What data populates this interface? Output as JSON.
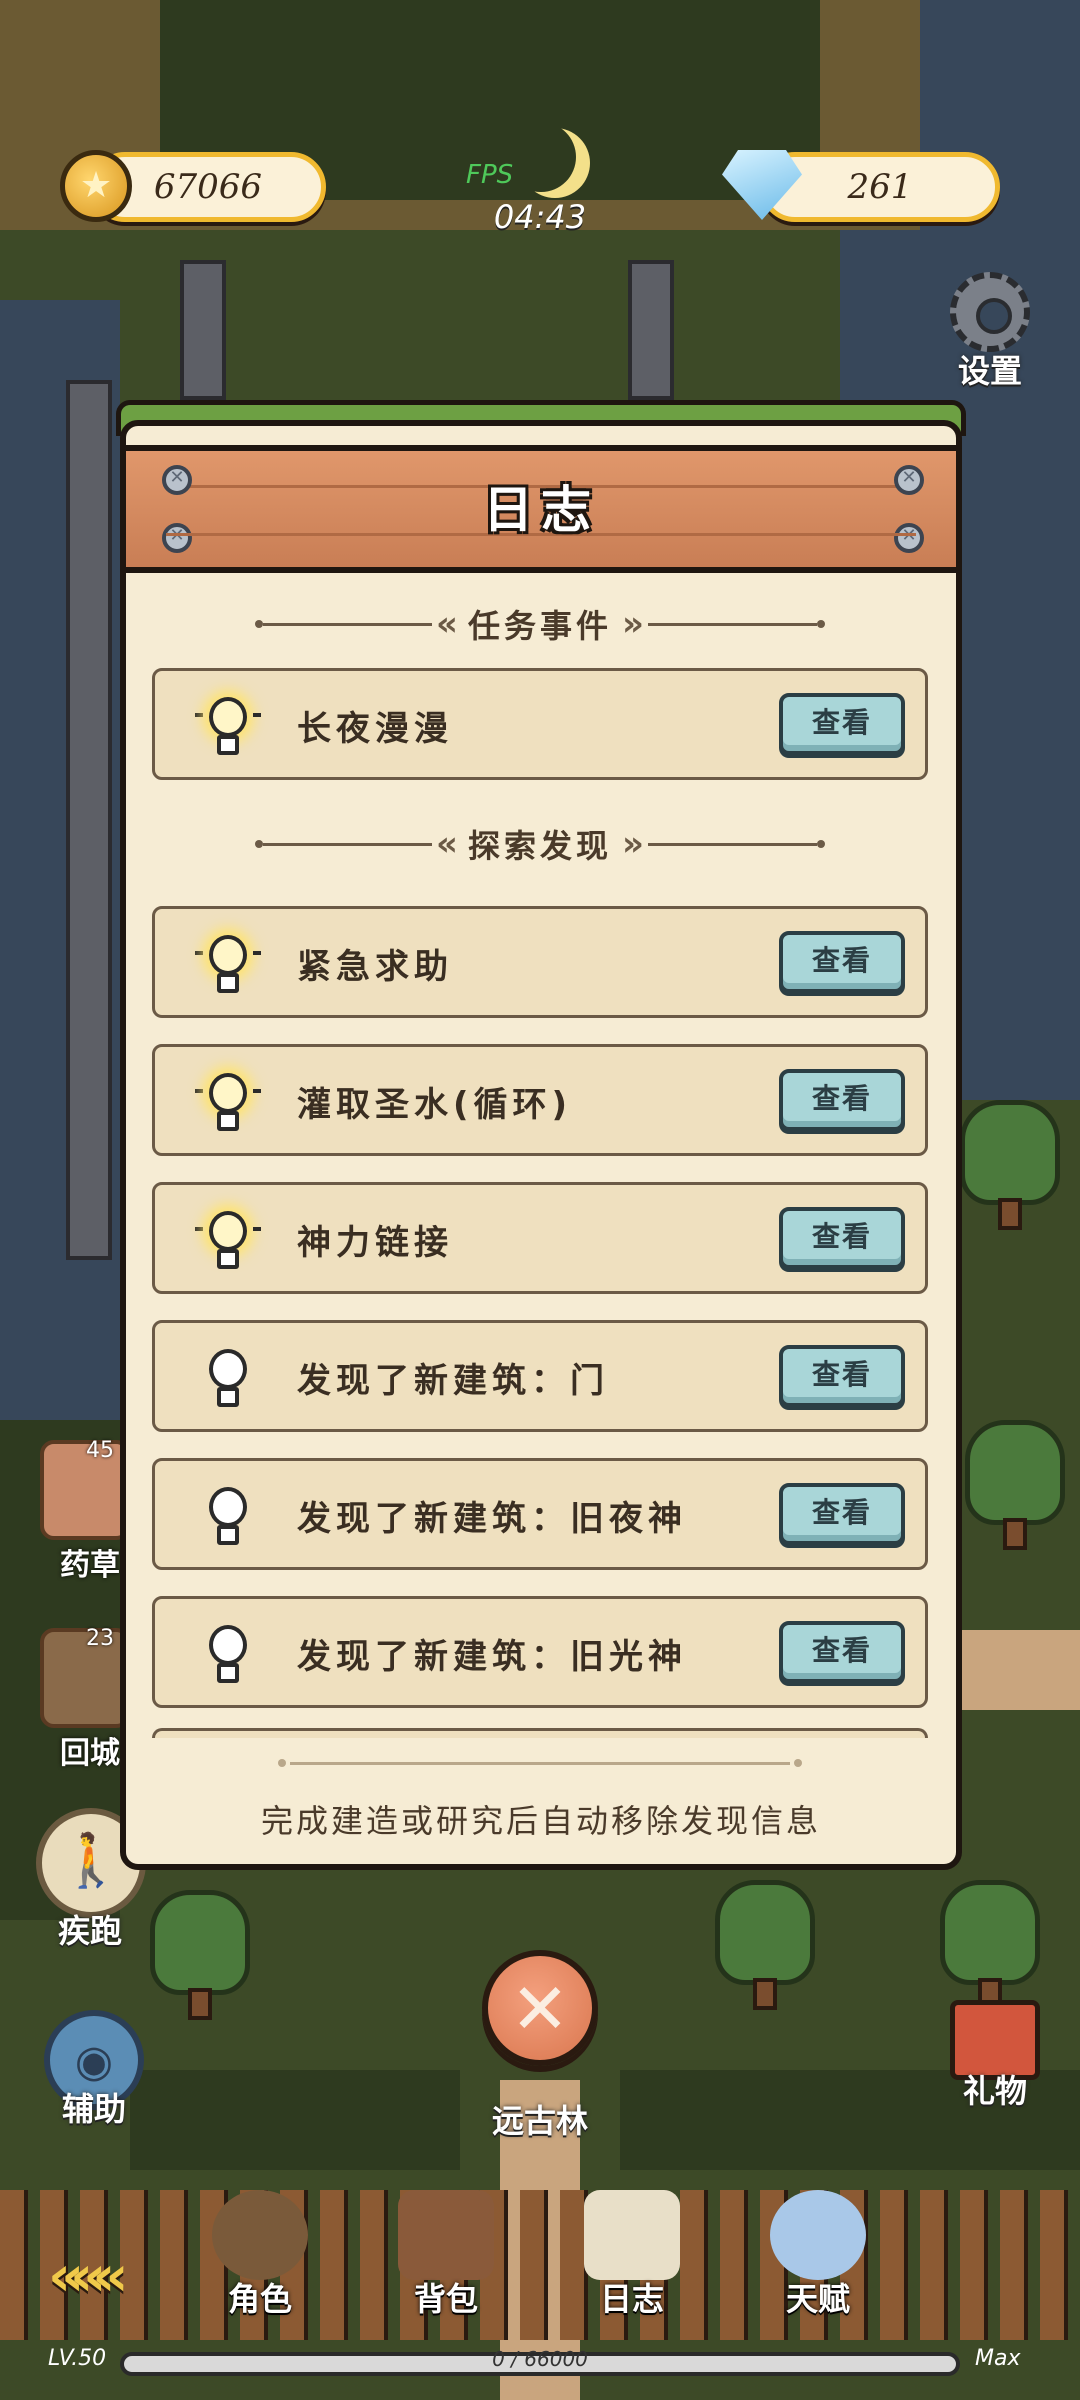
{
  "hud": {
    "gold": "67066",
    "gems": "261",
    "fps_label": "FPS",
    "timer": "04:43",
    "settings_label": "设置",
    "gift_label": "礼物"
  },
  "side": {
    "herb_count": "45",
    "herb_label": "药草",
    "item2_count": "23",
    "item2_label": "回城",
    "sprint_label": "疾跑",
    "assist_label": "辅助"
  },
  "dialog": {
    "title": "日志",
    "section1": "任务事件",
    "section2": "探索发现",
    "view_label": "查看",
    "quests": [
      {
        "label": "长夜漫漫",
        "lit": true
      }
    ],
    "discoveries": [
      {
        "label": "紧急求助",
        "lit": true
      },
      {
        "label": "灌取圣水(循环)",
        "lit": true
      },
      {
        "label": "神力链接",
        "lit": true
      },
      {
        "label": "发现了新建筑：门",
        "lit": false
      },
      {
        "label": "发现了新建筑：旧夜神",
        "lit": false
      },
      {
        "label": "发现了新建筑：旧光神",
        "lit": false
      }
    ],
    "footer": "完成建造或研究后自动移除发现信息"
  },
  "location": "远古林",
  "nav": {
    "character": "角色",
    "bag": "背包",
    "log": "日志",
    "talent": "天赋"
  },
  "xp": {
    "level": "LV.50",
    "progress": "0 / 66000",
    "fraction": 0,
    "max": "Max"
  },
  "colors": {
    "panel": "#f6ecd4",
    "plank": "#d9875c",
    "view_button": "#a9d6d8",
    "gold_border": "#f0b92f"
  }
}
